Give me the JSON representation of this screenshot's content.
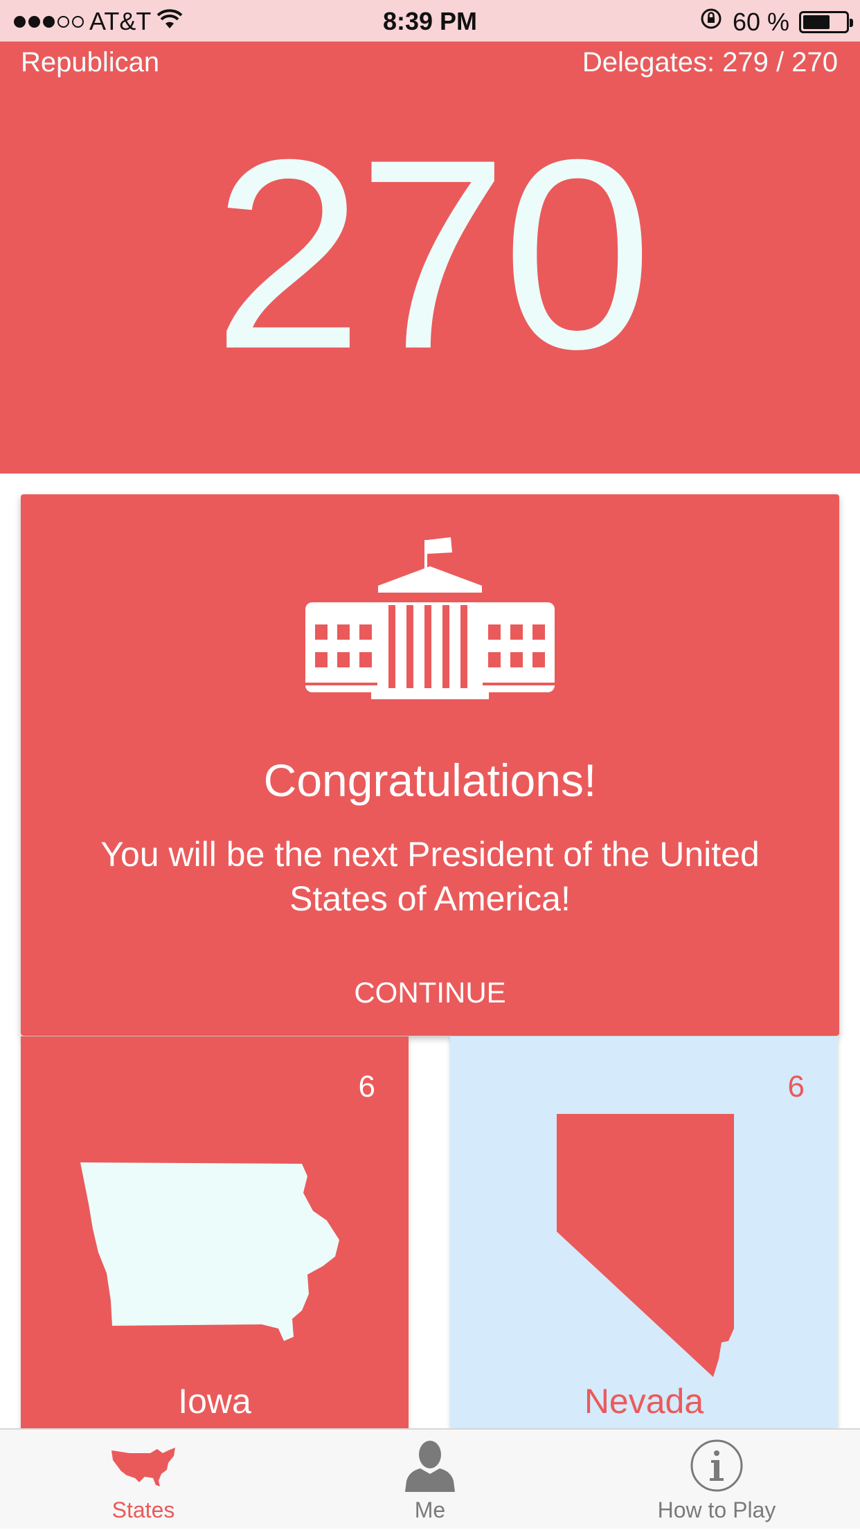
{
  "status_bar": {
    "carrier": "AT&T",
    "time": "8:39 PM",
    "battery_percent": "60 %",
    "battery_level": 0.6,
    "signal_bars": 3,
    "signal_total": 5
  },
  "header": {
    "party": "Republican",
    "delegates": "Delegates: 279 / 270",
    "big_number": "270"
  },
  "modal": {
    "icon": "white-house-icon",
    "title": "Congratulations!",
    "message": "You will be the next President of the United States of America!",
    "continue_label": "CONTINUE"
  },
  "states": [
    {
      "name": "Iowa",
      "count": "6",
      "icon": "iowa-map-icon"
    },
    {
      "name": "Nevada",
      "count": "6",
      "icon": "nevada-map-icon"
    }
  ],
  "tabs": [
    {
      "label": "States",
      "icon": "us-map-icon",
      "active": true
    },
    {
      "label": "Me",
      "icon": "person-icon",
      "active": false
    },
    {
      "label": "How to Play",
      "icon": "info-icon",
      "active": false
    }
  ],
  "colors": {
    "accent": "#ea5a5b",
    "light_blue": "#d5eafb",
    "status_bar": "#f9d4d6",
    "inactive_tab": "#7a7a7a"
  }
}
